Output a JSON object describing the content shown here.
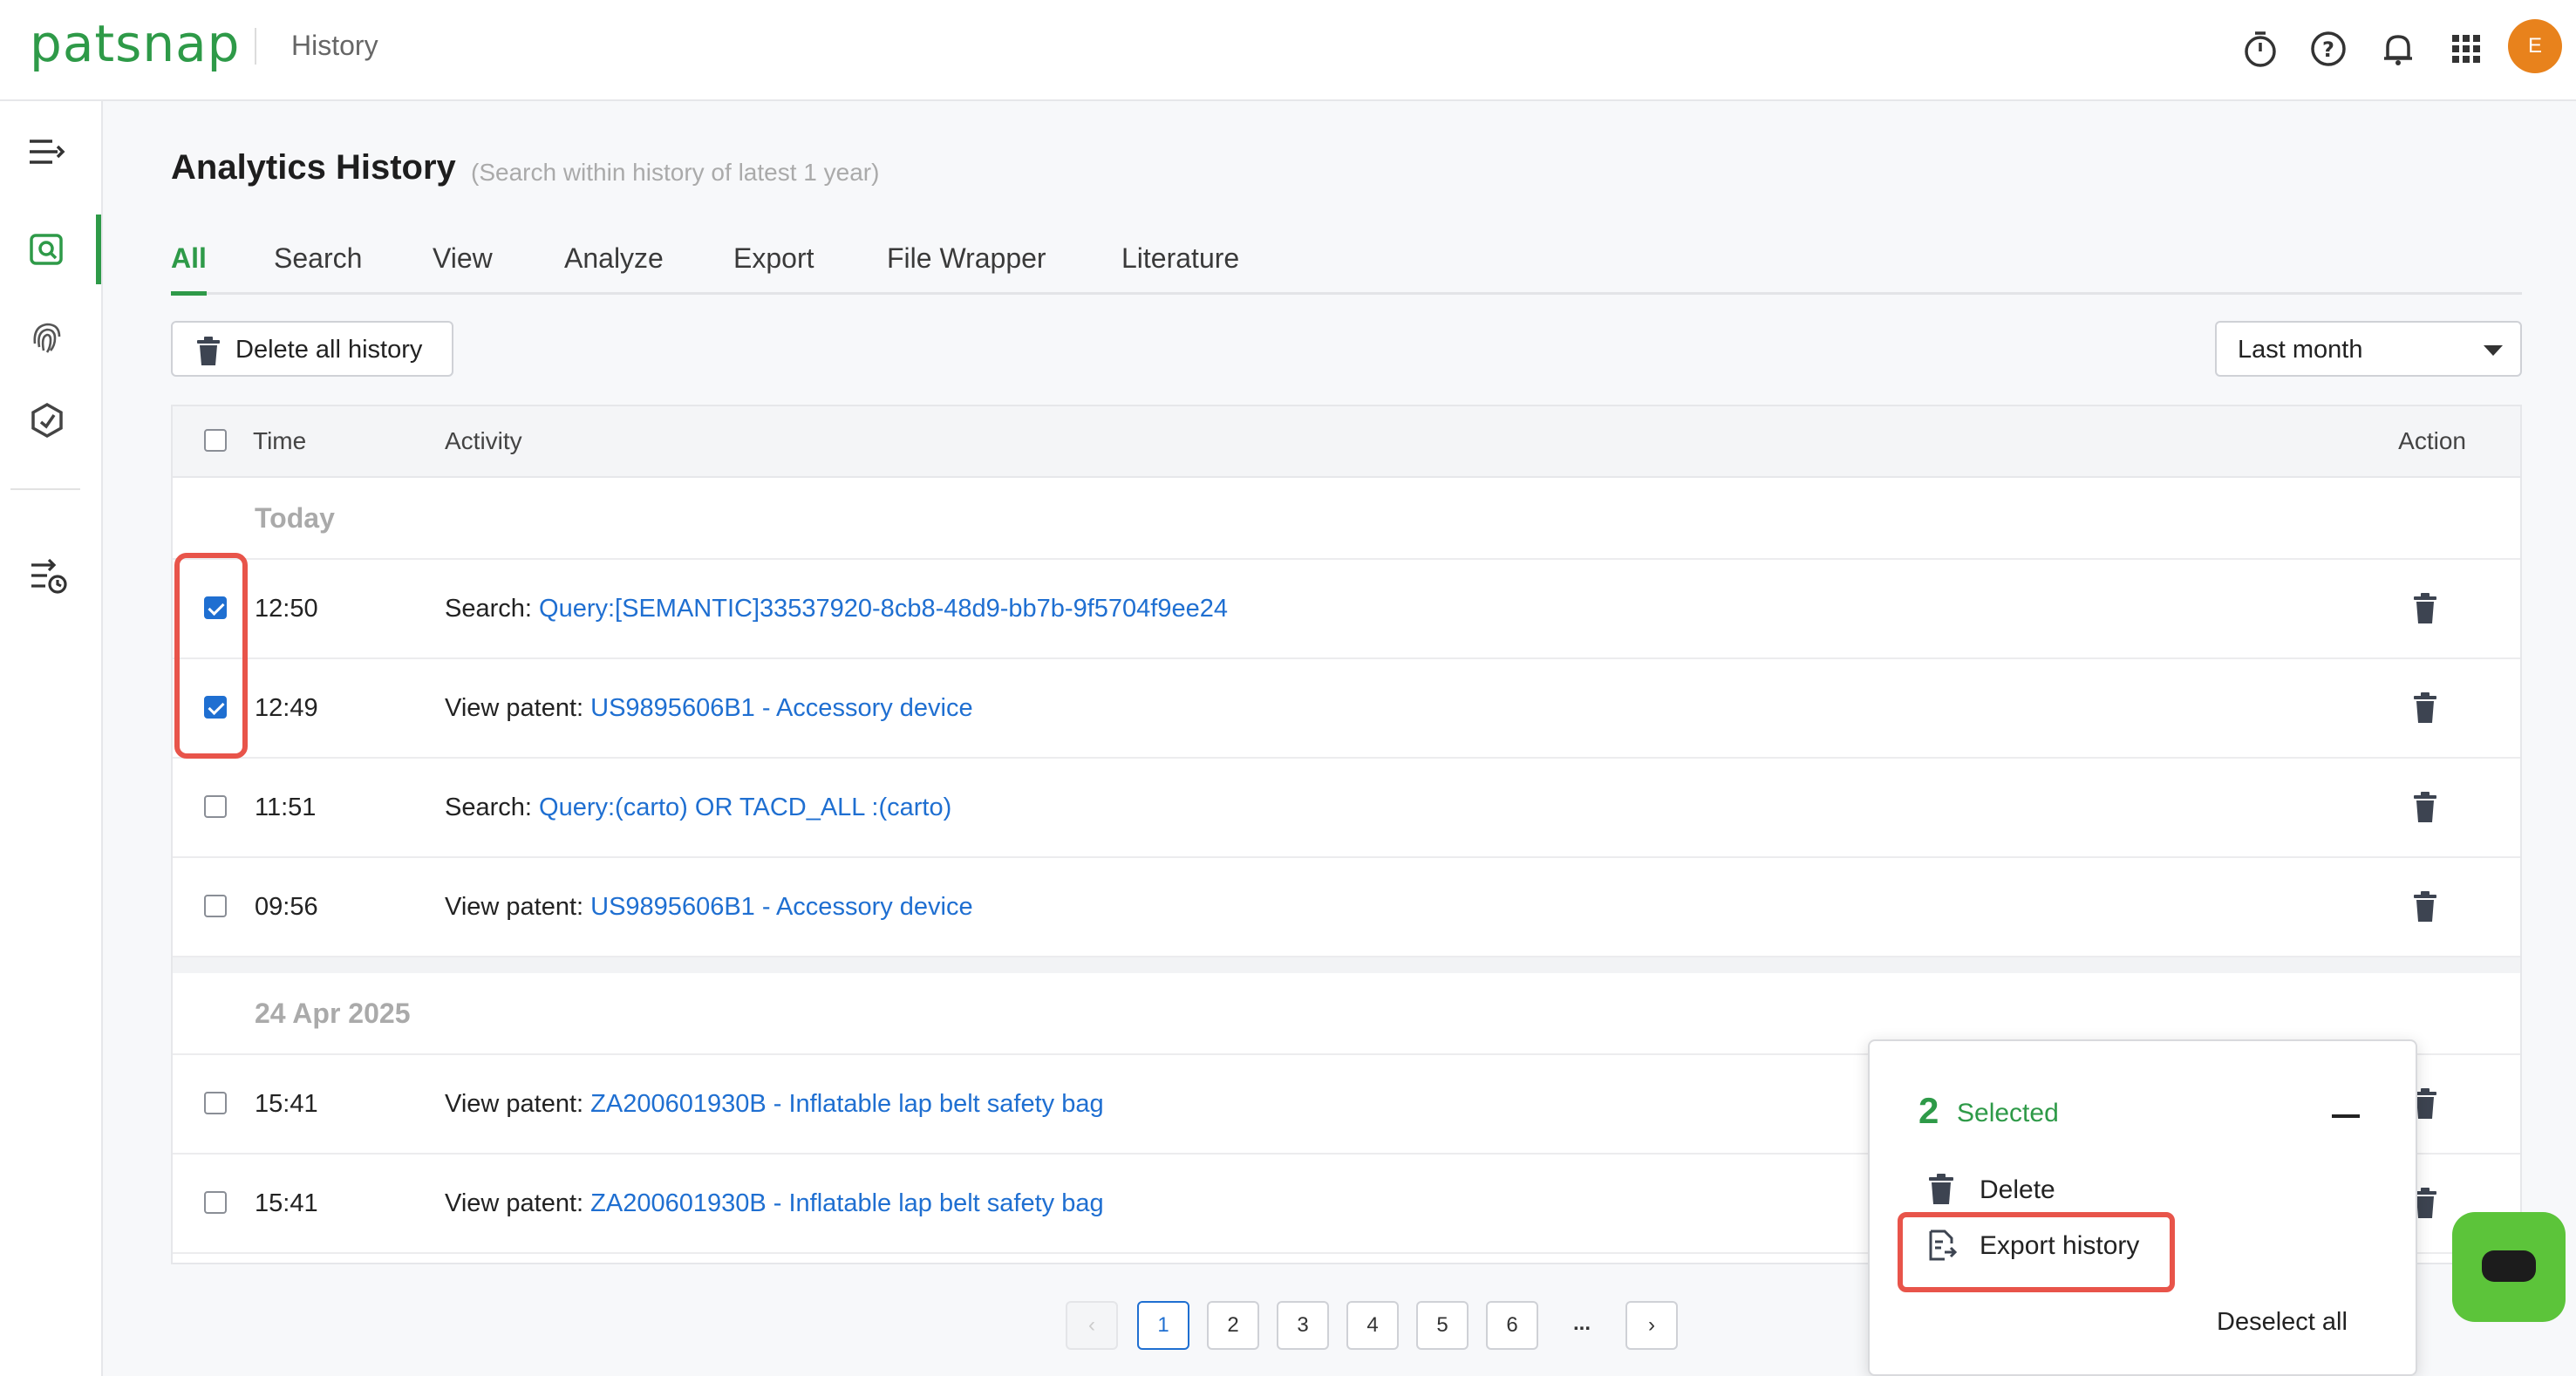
{
  "header": {
    "logo": "patsnap",
    "title": "History",
    "icons": [
      "timer-icon",
      "help-icon",
      "bell-icon",
      "apps-grid-icon"
    ],
    "avatar_initial": "E",
    "avatar_color": "#e8821c"
  },
  "sidebar": {
    "items": [
      "menu-collapse-icon",
      "search-history-icon",
      "fingerprint-icon",
      "hexagon-icon",
      "export-history-icon"
    ],
    "active": "search-history-icon"
  },
  "page": {
    "title": "Analytics History",
    "subtitle": "(Search within history of latest 1 year)"
  },
  "tabs": [
    "All",
    "Search",
    "View",
    "Analyze",
    "Export",
    "File Wrapper",
    "Literature"
  ],
  "active_tab": "All",
  "toolbar": {
    "delete_all": "Delete all history",
    "range": "Last month"
  },
  "table": {
    "headers": {
      "time": "Time",
      "activity": "Activity",
      "action": "Action"
    },
    "groups": [
      {
        "label": "Today",
        "rows": [
          {
            "checked": true,
            "time": "12:50",
            "type": "Search:",
            "link": "Query:[SEMANTIC]33537920-8cb8-48d9-bb7b-9f5704f9ee24"
          },
          {
            "checked": true,
            "time": "12:49",
            "type": "View patent:",
            "link": "US9895606B1 - Accessory device"
          },
          {
            "checked": false,
            "time": "11:51",
            "type": "Search:",
            "link": "Query:(carto) OR TACD_ALL :(carto)"
          },
          {
            "checked": false,
            "time": "09:56",
            "type": "View patent:",
            "link": "US9895606B1 - Accessory device"
          }
        ]
      },
      {
        "label": "24 Apr 2025",
        "rows": [
          {
            "checked": false,
            "time": "15:41",
            "type": "View patent:",
            "link": "ZA200601930B - Inflatable lap belt safety bag"
          },
          {
            "checked": false,
            "time": "15:41",
            "type": "View patent:",
            "link": "ZA200601930B - Inflatable lap belt safety bag"
          }
        ]
      }
    ]
  },
  "pagination": {
    "prev": "‹",
    "pages": [
      "1",
      "2",
      "3",
      "4",
      "5",
      "6"
    ],
    "active_page": "1",
    "ellipsis": "...",
    "next": "›"
  },
  "selection_panel": {
    "count": "2",
    "label": "Selected",
    "delete": "Delete",
    "export": "Export history",
    "deselect": "Deselect all"
  },
  "colors": {
    "brand_green": "#2e9a48",
    "link_blue": "#1f6fd1",
    "highlight_red": "#e8544a",
    "chat_green": "#5cc43a"
  }
}
